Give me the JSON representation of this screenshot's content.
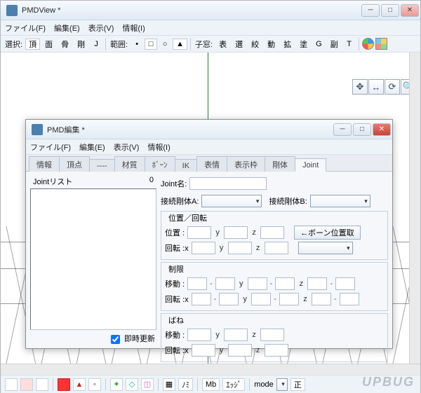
{
  "main": {
    "title": "PMDView *",
    "menu": {
      "file": "ファイル(F)",
      "edit": "編集(E)",
      "view": "表示(V)",
      "info": "情報(I)"
    },
    "toolbar": {
      "select_label": "選択:",
      "btns1": [
        "頂",
        "面",
        "骨",
        "剛",
        "J"
      ],
      "range_label": "範囲:",
      "child_label": "子窓:",
      "btns2": [
        "表",
        "選",
        "絞",
        "動",
        "拡",
        "塗",
        "G",
        "副",
        "T"
      ]
    },
    "status": {
      "nomi": "ﾉﾐ",
      "mb": "Mb",
      "edge": "ｴｯｼﾞ",
      "mode": "mode",
      "right": "正"
    },
    "watermark": "UPBUG"
  },
  "child": {
    "title": "PMD編集 *",
    "menu": {
      "file": "ファイル(F)",
      "edit": "編集(E)",
      "view": "表示(V)",
      "info": "情報(I)"
    },
    "tabs": [
      "情報",
      "頂点",
      "----",
      "材質",
      "ﾎﾞｰﾝ",
      "IK",
      "表情",
      "表示枠",
      "剛体",
      "Joint"
    ],
    "active_tab": 9,
    "list_label": "Jointリスト",
    "list_count": "0",
    "autoupdate": "即時更新",
    "r": {
      "name_label": "Joint名:",
      "rigA": "接続剛体A:",
      "rigB": "接続剛体B:",
      "fs_posrot": "位置／回転",
      "pos_label": "位置 :",
      "rot_label": "回転 :x",
      "axis_y": "y",
      "axis_z": "z",
      "bonepos_btn": "←ボーン位置取",
      "fs_limit": "制限",
      "move_label": "移動 :",
      "fs_spring": "ばね",
      "dash": "-"
    }
  }
}
